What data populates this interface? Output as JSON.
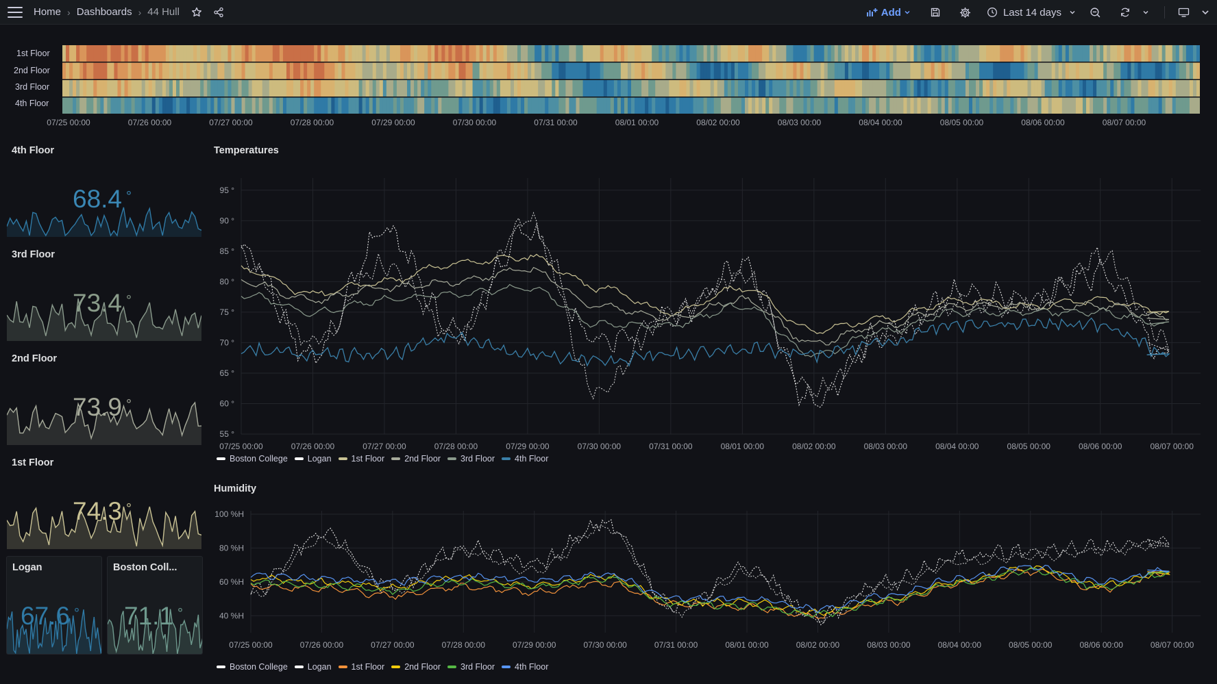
{
  "topbar": {
    "breadcrumbs": [
      "Home",
      "Dashboards",
      "44 Hull"
    ],
    "add_label": "Add",
    "time_range": "Last 14 days"
  },
  "colors": {
    "fourth": "#3a7fa8",
    "third": "#8a9a8c",
    "second": "#a6aa9a",
    "first": "#c9c294",
    "logan": "#2f7aa6",
    "boston": "#6f9a8e",
    "humid_first": "#f2913a",
    "humid_second": "#f2cc0c",
    "humid_third": "#56b845",
    "humid_fourth": "#5794f2"
  },
  "heatmap": {
    "rows": [
      "1st Floor",
      "2nd Floor",
      "3rd Floor",
      "4th Floor"
    ],
    "x_labels": [
      "07/25 00:00",
      "07/26 00:00",
      "07/27 00:00",
      "07/28 00:00",
      "07/29 00:00",
      "07/30 00:00",
      "07/31 00:00",
      "08/01 00:00",
      "08/02 00:00",
      "08/03 00:00",
      "08/04 00:00",
      "08/05 00:00",
      "08/06 00:00",
      "08/07 00:00"
    ]
  },
  "stats": {
    "fourth": {
      "title": "4th Floor",
      "value": "68.4",
      "unit": "°"
    },
    "third": {
      "title": "3rd Floor",
      "value": "73.4",
      "unit": "°"
    },
    "second": {
      "title": "2nd Floor",
      "value": "73.9",
      "unit": "°"
    },
    "first": {
      "title": "1st Floor",
      "value": "74.3",
      "unit": "°"
    },
    "logan": {
      "title": "Logan",
      "value": "67.6",
      "unit": "°"
    },
    "boston": {
      "title": "Boston Coll...",
      "value": "71.1",
      "unit": "°"
    }
  },
  "chart_data": [
    {
      "type": "line",
      "title": "Temperatures",
      "y_ticks": [
        "95 °",
        "90 °",
        "85 °",
        "80 °",
        "75 °",
        "70 °",
        "65 °",
        "60 °",
        "55 °"
      ],
      "ylim": [
        55,
        97
      ],
      "x": [
        "07/25 00:00",
        "07/26 00:00",
        "07/27 00:00",
        "07/28 00:00",
        "07/29 00:00",
        "07/30 00:00",
        "07/31 00:00",
        "08/01 00:00",
        "08/02 00:00",
        "08/03 00:00",
        "08/04 00:00",
        "08/05 00:00",
        "08/06 00:00",
        "08/07 00:00"
      ],
      "legend": [
        "Boston College",
        "Logan",
        "1st Floor",
        "2nd Floor",
        "3rd Floor",
        "4th Floor"
      ],
      "series": [
        {
          "name": "Boston College",
          "values": [
            85,
            68,
            88,
            72,
            88,
            70,
            74,
            82,
            60,
            72,
            78,
            77,
            81,
            68
          ]
        },
        {
          "name": "Logan",
          "values": [
            84,
            70,
            83,
            71,
            90,
            62,
            75,
            81,
            62,
            71,
            76,
            76,
            84,
            70
          ]
        },
        {
          "name": "1st Floor",
          "values": [
            82,
            78,
            80,
            83,
            84,
            79,
            75,
            79,
            72,
            74,
            77,
            76,
            77,
            75
          ]
        },
        {
          "name": "2nd Floor",
          "values": [
            80,
            77,
            79,
            80,
            82,
            76,
            74,
            77,
            70,
            73,
            76,
            76,
            76,
            74
          ]
        },
        {
          "name": "3rd Floor",
          "values": [
            78,
            75,
            77,
            78,
            79,
            73,
            73,
            76,
            68,
            72,
            75,
            75,
            75,
            73
          ]
        },
        {
          "name": "4th Floor",
          "values": [
            69,
            68,
            68,
            71,
            68,
            67,
            68,
            69,
            68,
            70,
            73,
            73,
            73,
            68
          ]
        }
      ]
    },
    {
      "type": "line",
      "title": "Humidity",
      "y_ticks": [
        "100 %H",
        "80 %H",
        "60 %H",
        "40 %H"
      ],
      "ylim": [
        30,
        102
      ],
      "x": [
        "07/25 00:00",
        "07/26 00:00",
        "07/27 00:00",
        "07/28 00:00",
        "07/29 00:00",
        "07/30 00:00",
        "07/31 00:00",
        "08/01 00:00",
        "08/02 00:00",
        "08/03 00:00",
        "08/04 00:00",
        "08/05 00:00",
        "08/06 00:00",
        "08/07 00:00"
      ],
      "legend": [
        "Boston College",
        "Logan",
        "1st Floor",
        "2nd Floor",
        "3rd Floor",
        "4th Floor"
      ],
      "series": [
        {
          "name": "Boston College",
          "values": [
            55,
            88,
            58,
            80,
            70,
            95,
            45,
            68,
            40,
            60,
            75,
            78,
            80,
            85
          ]
        },
        {
          "name": "Logan",
          "values": [
            52,
            85,
            55,
            78,
            66,
            92,
            42,
            65,
            38,
            58,
            72,
            75,
            78,
            82
          ]
        },
        {
          "name": "1st Floor",
          "values": [
            57,
            56,
            52,
            57,
            54,
            59,
            47,
            45,
            40,
            48,
            59,
            66,
            56,
            66
          ]
        },
        {
          "name": "2nd Floor",
          "values": [
            62,
            60,
            57,
            62,
            58,
            63,
            48,
            48,
            42,
            50,
            60,
            68,
            58,
            66
          ]
        },
        {
          "name": "3rd Floor",
          "values": [
            60,
            58,
            55,
            60,
            57,
            62,
            47,
            46,
            41,
            49,
            59,
            67,
            57,
            65
          ]
        },
        {
          "name": "4th Floor",
          "values": [
            64,
            62,
            60,
            63,
            61,
            64,
            50,
            50,
            44,
            52,
            62,
            69,
            60,
            67
          ]
        }
      ]
    }
  ]
}
